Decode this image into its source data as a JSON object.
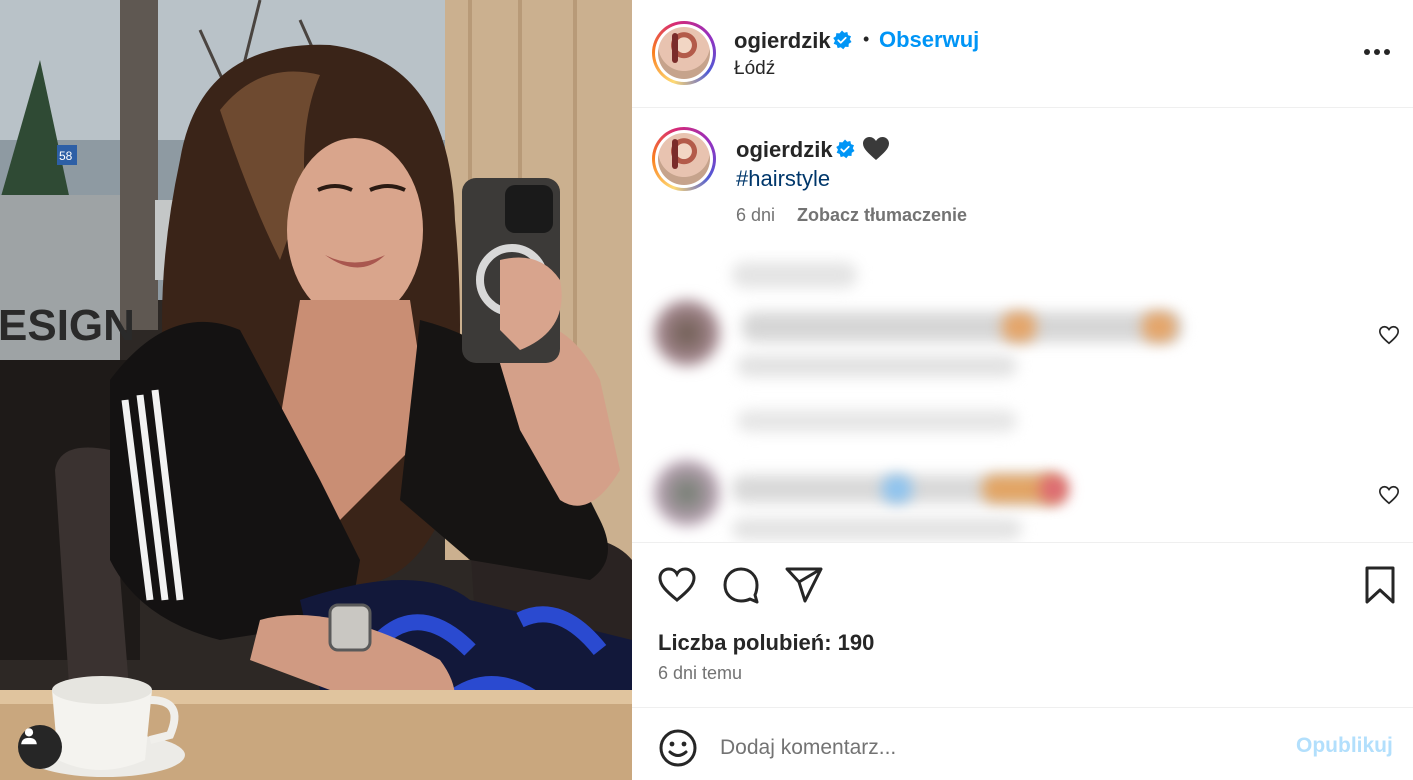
{
  "post": {
    "username": "ogierdzik",
    "location": "Łódź",
    "follow_label": "Obserwuj",
    "separator": "•",
    "caption_hashtag": "#hairstyle",
    "caption_time": "6 dni",
    "translate_label": "Zobacz tłumaczenie",
    "likes_label": "Liczba polubień: 190",
    "post_time": "6 dni temu"
  },
  "comment_box": {
    "placeholder": "Dodaj komentarz...",
    "publish_label": "Opublikuj"
  },
  "photo": {
    "storefront_text": "ESIGN",
    "sign_number": "58"
  },
  "icons": {
    "more": "more-options-icon",
    "verified": "verified-badge-icon",
    "heart": "heart-icon",
    "comment": "comment-icon",
    "share": "share-icon",
    "save": "bookmark-icon",
    "emoji": "emoji-icon",
    "user_tag": "user-tag-icon"
  },
  "colors": {
    "link_blue": "#0095f6",
    "hashtag_blue": "#00376b",
    "verified_blue": "#0095f6",
    "muted_text": "#737373",
    "publish_disabled": "#b2dffc"
  }
}
